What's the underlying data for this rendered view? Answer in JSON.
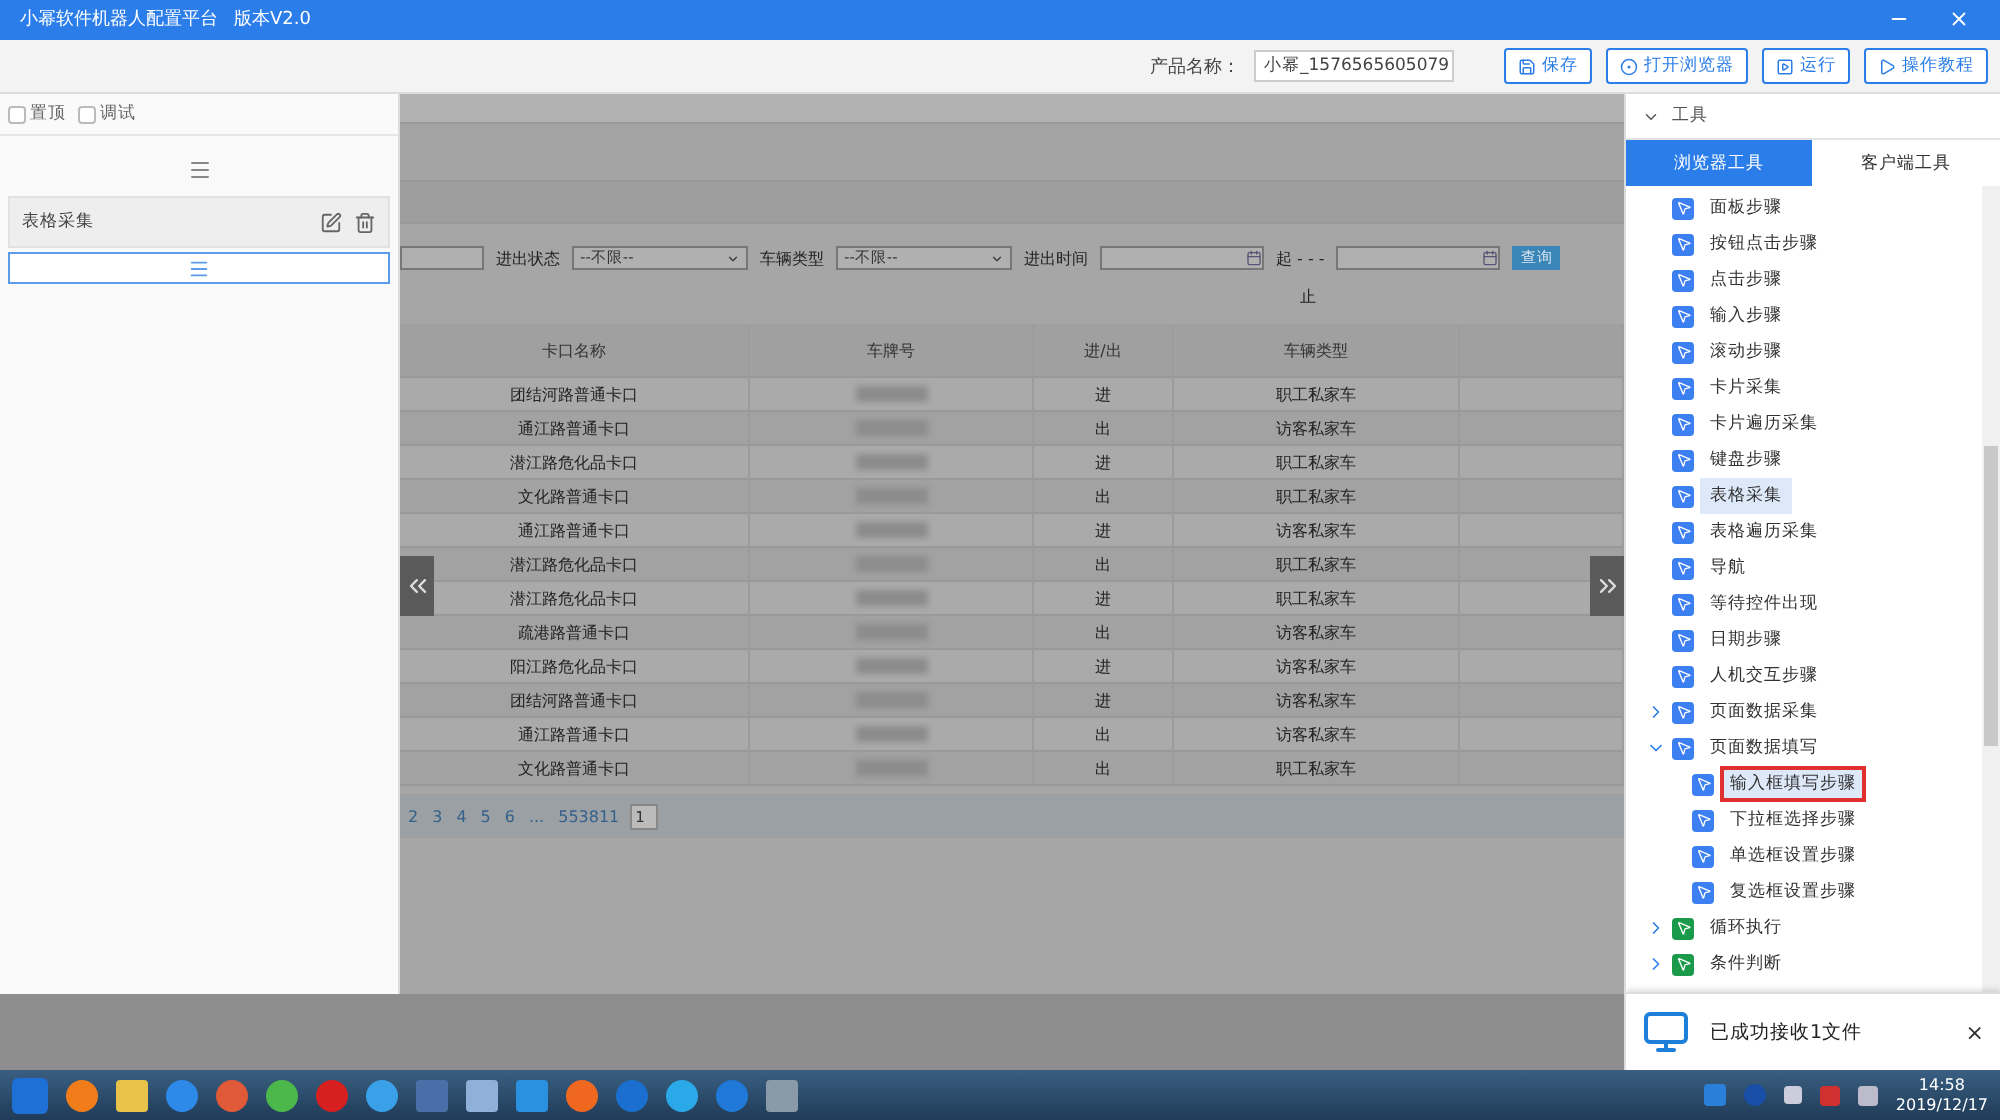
{
  "window": {
    "title": "小幂软件机器人配置平台",
    "version": "版本V2.0"
  },
  "toolbar": {
    "product_label": "产品名称：",
    "product_value": "小幂_1576565605079",
    "buttons": [
      {
        "label": "保存",
        "kind": "save"
      },
      {
        "label": "打开浏览器",
        "kind": "browser"
      },
      {
        "label": "运行",
        "kind": "run"
      },
      {
        "label": "操作教程",
        "kind": "tutorial"
      }
    ]
  },
  "left_panel": {
    "options": [
      {
        "label": "置顶",
        "checked": false
      },
      {
        "label": "调试",
        "checked": false
      }
    ],
    "steps": [
      {
        "label": "表格采集"
      }
    ]
  },
  "webpage": {
    "filters": [
      {
        "kind": "input"
      },
      {
        "kind": "select",
        "label": "进出状态",
        "value": "--不限--"
      },
      {
        "kind": "select",
        "label": "车辆类型",
        "value": "--不限--"
      },
      {
        "kind": "date",
        "label": "进出时间"
      },
      {
        "kind": "text",
        "label": "起 - - -"
      },
      {
        "kind": "date"
      },
      {
        "kind": "button",
        "label": "查询"
      }
    ],
    "filter_note": "止",
    "table": {
      "columns": [
        "卡口名称",
        "车牌号",
        "进/出",
        "车辆类型",
        ""
      ],
      "rows": [
        {
          "gate": "团结河路普通卡口",
          "direction": "进",
          "type": "职工私家车"
        },
        {
          "gate": "通江路普通卡口",
          "direction": "出",
          "type": "访客私家车"
        },
        {
          "gate": "潜江路危化品卡口",
          "direction": "进",
          "type": "职工私家车"
        },
        {
          "gate": "文化路普通卡口",
          "direction": "出",
          "type": "职工私家车"
        },
        {
          "gate": "通江路普通卡口",
          "direction": "进",
          "type": "访客私家车"
        },
        {
          "gate": "潜江路危化品卡口",
          "direction": "出",
          "type": "职工私家车"
        },
        {
          "gate": "潜江路危化品卡口",
          "direction": "进",
          "type": "职工私家车"
        },
        {
          "gate": "疏港路普通卡口",
          "direction": "出",
          "type": "访客私家车"
        },
        {
          "gate": "阳江路危化品卡口",
          "direction": "进",
          "type": "访客私家车"
        },
        {
          "gate": "团结河路普通卡口",
          "direction": "进",
          "type": "访客私家车"
        },
        {
          "gate": "通江路普通卡口",
          "direction": "出",
          "type": "访客私家车"
        },
        {
          "gate": "文化路普通卡口",
          "direction": "出",
          "type": "职工私家车"
        }
      ]
    },
    "pagination": {
      "pages": [
        "2",
        "3",
        "4",
        "5",
        "6",
        "...",
        "553811"
      ],
      "page_input": "1"
    }
  },
  "tools": {
    "title": "工具",
    "tabs": [
      {
        "label": "浏览器工具",
        "selected": true
      },
      {
        "label": "客户端工具",
        "selected": false
      }
    ],
    "items": [
      {
        "kind": "step",
        "label": "面板步骤",
        "selected": false,
        "annotated": false,
        "color": "#3b7ff0"
      },
      {
        "kind": "step",
        "label": "按钮点击步骤",
        "selected": false,
        "annotated": false,
        "color": "#3b7ff0"
      },
      {
        "kind": "step",
        "label": "点击步骤",
        "selected": false,
        "annotated": false,
        "color": "#3b7ff0"
      },
      {
        "kind": "step",
        "label": "输入步骤",
        "selected": false,
        "annotated": false,
        "color": "#3b7ff0"
      },
      {
        "kind": "step",
        "label": "滚动步骤",
        "selected": false,
        "annotated": false,
        "color": "#3b7ff0"
      },
      {
        "kind": "step",
        "label": "卡片采集",
        "selected": false,
        "annotated": false,
        "color": "#3b7ff0"
      },
      {
        "kind": "step",
        "label": "卡片遍历采集",
        "selected": false,
        "annotated": false,
        "color": "#3b7ff0"
      },
      {
        "kind": "step",
        "label": "键盘步骤",
        "selected": false,
        "annotated": false,
        "color": "#3b7ff0"
      },
      {
        "kind": "step",
        "label": "表格采集",
        "selected": true,
        "annotated": false,
        "color": "#3b7ff0"
      },
      {
        "kind": "step",
        "label": "表格遍历采集",
        "selected": false,
        "annotated": false,
        "color": "#3b7ff0"
      },
      {
        "kind": "step",
        "label": "导航",
        "selected": false,
        "annotated": false,
        "color": "#3b7ff0"
      },
      {
        "kind": "step",
        "label": "等待控件出现",
        "selected": false,
        "annotated": false,
        "color": "#3b7ff0"
      },
      {
        "kind": "step",
        "label": "日期步骤",
        "selected": false,
        "annotated": false,
        "color": "#3b7ff0"
      },
      {
        "kind": "step",
        "label": "人机交互步骤",
        "selected": false,
        "annotated": false,
        "color": "#3b7ff0"
      },
      {
        "kind": "group",
        "label": "页面数据采集",
        "expanded": false,
        "selected": false,
        "annotated": false,
        "color": "#3b7ff0"
      },
      {
        "kind": "group",
        "label": "页面数据填写",
        "expanded": true,
        "selected": false,
        "annotated": false,
        "color": "#3b7ff0",
        "children": [
          {
            "kind": "step",
            "label": "输入框填写步骤",
            "selected": true,
            "annotated": true,
            "color": "#3b7ff0"
          },
          {
            "kind": "step",
            "label": "下拉框选择步骤",
            "selected": false,
            "annotated": false,
            "color": "#3b7ff0"
          },
          {
            "kind": "step",
            "label": "单选框设置步骤",
            "selected": false,
            "annotated": false,
            "color": "#3b7ff0"
          },
          {
            "kind": "step",
            "label": "复选框设置步骤",
            "selected": false,
            "annotated": false,
            "color": "#3b7ff0"
          }
        ]
      },
      {
        "kind": "group",
        "label": "循环执行",
        "expanded": false,
        "selected": false,
        "color": "#1a9a4a"
      },
      {
        "kind": "group",
        "label": "条件判断",
        "expanded": false,
        "selected": false,
        "color": "#1a9a4a"
      }
    ]
  },
  "notification": {
    "message": "已成功接收1文件",
    "close": "×"
  },
  "taskbar": {
    "time": "14:58",
    "date": "2019/12/17"
  }
}
